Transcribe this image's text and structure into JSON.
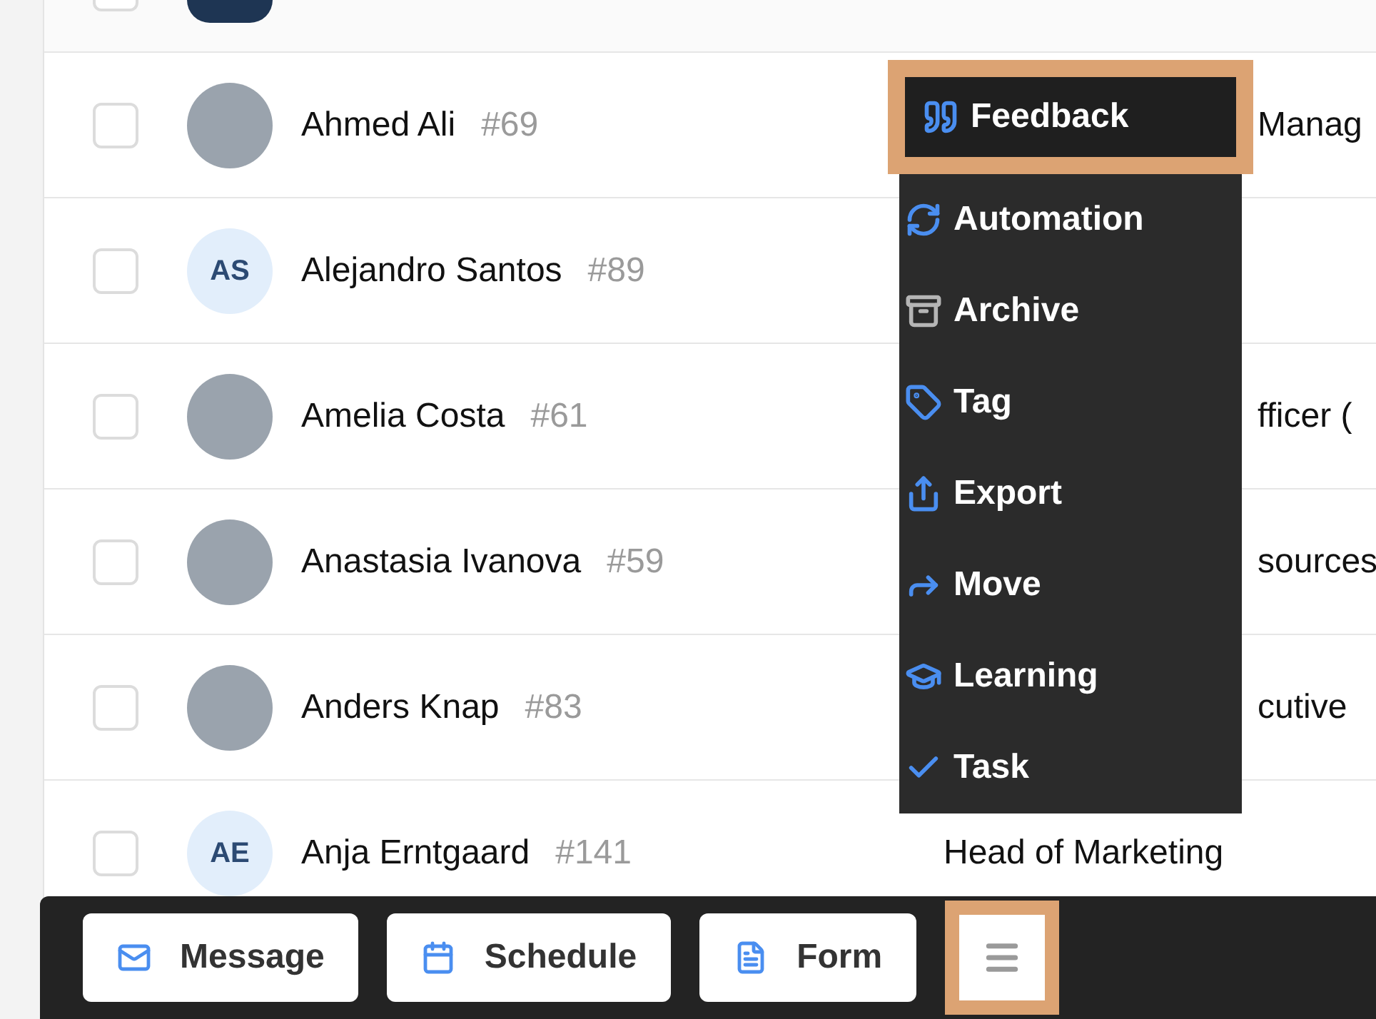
{
  "rows": [
    {
      "avatar": {
        "kind": "photo"
      },
      "checked": false
    },
    {
      "avatar": {
        "kind": "photo"
      },
      "name": "Ahmed Ali",
      "number": "#69",
      "title": "Manag",
      "checked": false
    },
    {
      "avatar": {
        "kind": "initials",
        "text": "AS"
      },
      "name": "Alejandro Santos",
      "number": "#89",
      "checked": false
    },
    {
      "avatar": {
        "kind": "photo"
      },
      "name": "Amelia Costa",
      "number": "#61",
      "title": "fficer (",
      "checked": false
    },
    {
      "avatar": {
        "kind": "photo"
      },
      "name": "Anastasia Ivanova",
      "number": "#59",
      "title": "sources",
      "checked": false
    },
    {
      "avatar": {
        "kind": "photo"
      },
      "name": "Anders Knap",
      "number": "#83",
      "title": "cutive",
      "checked": false
    },
    {
      "avatar": {
        "kind": "initials",
        "text": "AE"
      },
      "name": "Anja Erntgaard",
      "number": "#141",
      "title": "Head of Marketing",
      "checked": false
    }
  ],
  "menu": {
    "items": [
      {
        "label": "Feedback",
        "selected": true
      },
      {
        "label": "Automation",
        "selected": false
      },
      {
        "label": "Archive",
        "selected": false
      },
      {
        "label": "Tag",
        "selected": false
      },
      {
        "label": "Export",
        "selected": false
      },
      {
        "label": "Move",
        "selected": false
      },
      {
        "label": "Learning",
        "selected": false
      },
      {
        "label": "Task",
        "selected": false
      }
    ]
  },
  "action_bar": {
    "buttons": [
      {
        "label": "Message"
      },
      {
        "label": "Schedule"
      },
      {
        "label": "Form"
      }
    ],
    "more_button": {
      "selected": true
    }
  }
}
